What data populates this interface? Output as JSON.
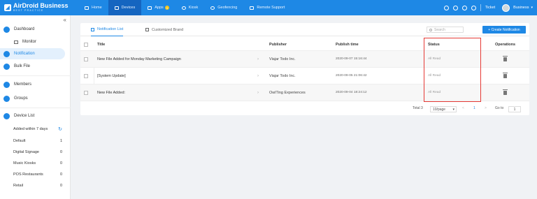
{
  "brand": {
    "name": "AirDroid Business",
    "sub": "BEST PRACTICE"
  },
  "nav": [
    {
      "label": "Home"
    },
    {
      "label": "Devices"
    },
    {
      "label": "Apps",
      "badge": "3"
    },
    {
      "label": "Kiosk"
    },
    {
      "label": "Geofencing"
    },
    {
      "label": "Remote Support"
    }
  ],
  "topright": {
    "ticket": "Ticket",
    "account": "Business"
  },
  "sidebar": {
    "collapse": "«",
    "dashboard": "Dashboard",
    "monitor": "Monitor",
    "notification": "Notification",
    "bulk_file": "Bulk File",
    "members": "Members",
    "groups": "Groups",
    "device_list": "Device List",
    "device_groups": [
      {
        "label": "Added within 7 days",
        "count": ""
      },
      {
        "label": "Default",
        "count": "1"
      },
      {
        "label": "Digital Signage",
        "count": "0"
      },
      {
        "label": "Music Kiosks",
        "count": "0"
      },
      {
        "label": "POS Restaurants",
        "count": "0"
      },
      {
        "label": "Retail",
        "count": "0"
      }
    ]
  },
  "tabs": {
    "list": "Notification List",
    "brand": "Customized Brand"
  },
  "search": {
    "placeholder": "Search"
  },
  "create_button": "+ Create Notification",
  "table": {
    "headers": {
      "title": "Title",
      "publisher": "Publisher",
      "time": "Publish time",
      "status": "Status",
      "ops": "Operations"
    },
    "rows": [
      {
        "title": "New File Added for Monday Marketing Campaign",
        "publisher": "Viajar Todo Inc.",
        "time": "2020-09-07 15:16:44",
        "status": "All Read"
      },
      {
        "title": "[System Update]",
        "publisher": "Viajar Todo Inc.",
        "time": "2020-09-05 21:06:42",
        "status": "All Read"
      },
      {
        "title": "New File Added:",
        "publisher": "OwlTing Experiences",
        "time": "2020-09-04 18:24:12",
        "status": "All Read"
      }
    ]
  },
  "pager": {
    "total": "Total 3",
    "per_page": "10/page",
    "prev": "<",
    "page": "1",
    "next": ">",
    "goto": "Go to",
    "goto_value": "1"
  },
  "colors": {
    "accent": "#1e88e5",
    "highlight": "#e53935"
  }
}
